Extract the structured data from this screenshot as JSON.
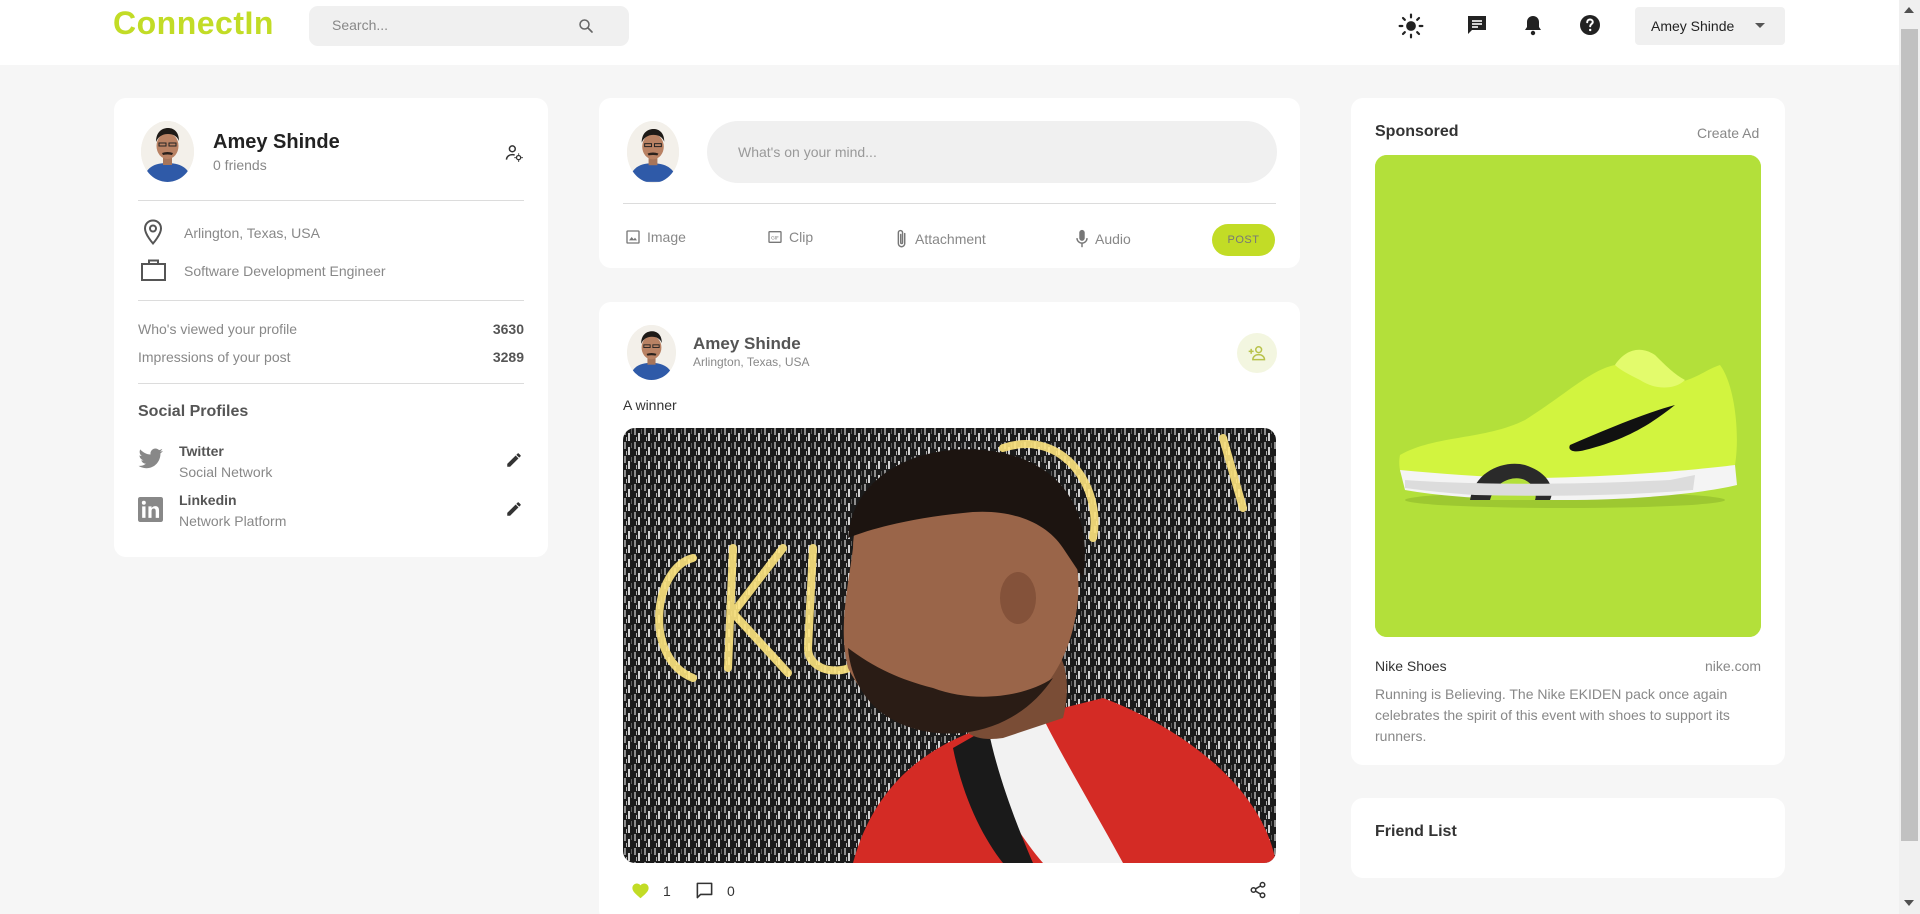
{
  "brand": {
    "logo": "ConnectIn",
    "accent": "#c2dc26"
  },
  "topbar": {
    "search_placeholder": "Search...",
    "icons": [
      "light-mode-icon",
      "message-icon",
      "notifications-icon",
      "help-icon"
    ],
    "user_menu": {
      "selected": "Amey Shinde"
    }
  },
  "profile": {
    "name": "Amey Shinde",
    "friends": "0 friends",
    "location": "Arlington, Texas, USA",
    "occupation": "Software Development Engineer",
    "stats": [
      {
        "label": "Who's viewed your profile",
        "value": "3630"
      },
      {
        "label": "Impressions of your post",
        "value": "3289"
      }
    ],
    "social_title": "Social Profiles",
    "socials": [
      {
        "name": "Twitter",
        "type": "Social Network",
        "icon": "twitter-icon"
      },
      {
        "name": "Linkedin",
        "type": "Network Platform",
        "icon": "linkedin-icon"
      }
    ]
  },
  "composer": {
    "placeholder": "What's on your mind...",
    "tools": [
      {
        "label": "Image",
        "icon": "image-icon"
      },
      {
        "label": "Clip",
        "icon": "gif-icon"
      },
      {
        "label": "Attachment",
        "icon": "attachment-icon"
      },
      {
        "label": "Audio",
        "icon": "mic-icon"
      }
    ],
    "post_label": "POST"
  },
  "post": {
    "author": "Amey Shinde",
    "location": "Arlington, Texas, USA",
    "text": "A winner",
    "likes": "1",
    "comments": "0"
  },
  "sponsored": {
    "title": "Sponsored",
    "create_ad": "Create Ad",
    "product": "Nike Shoes",
    "site": "nike.com",
    "description": "Running is Believing. The Nike EKIDEN pack once again celebrates the spirit of this event with shoes to support its runners."
  },
  "friend_list": {
    "title": "Friend List"
  }
}
